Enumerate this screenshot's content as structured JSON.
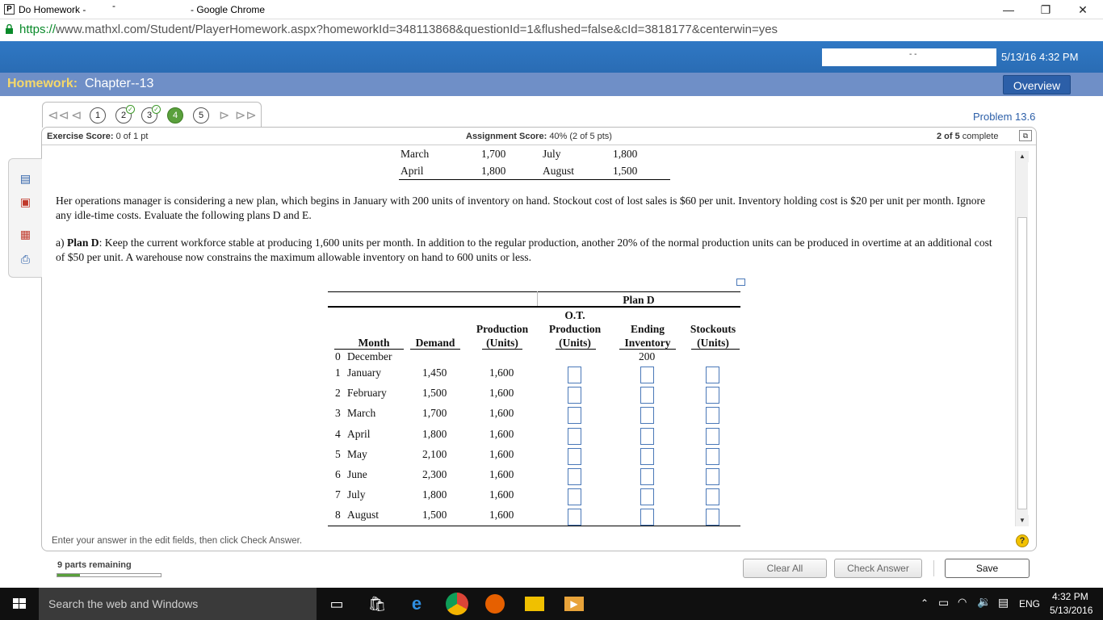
{
  "window": {
    "tab_title": "Do Homework -",
    "title_dash": "-",
    "browser": "- Google Chrome",
    "favicon": "P",
    "minimize": "—",
    "restore": "❐",
    "close": "✕"
  },
  "address": {
    "https": "https://",
    "rest": "www.mathxl.com/Student/PlayerHomework.aspx?homeworkId=348113868&questionId=1&flushed=false&cId=3818177&centerwin=yes"
  },
  "header": {
    "datetime": "5/13/16 4:32 PM",
    "redact_dash": "- -",
    "homework_label": "Homework:",
    "homework_title": "Chapter--13",
    "overview": "Overview"
  },
  "nav": {
    "questions": [
      "1",
      "2",
      "3",
      "4",
      "5"
    ],
    "problem": "Problem 13.6"
  },
  "score": {
    "exercise_label": "Exercise Score:",
    "exercise_value": "0 of 1 pt",
    "assignment_label": "Assignment Score:",
    "assignment_value": "40% (2 of 5 pts)",
    "complete_count": "2 of 5",
    "complete_label": "complete"
  },
  "top_table": {
    "rows": [
      [
        "March",
        "1,700",
        "July",
        "1,800"
      ],
      [
        "April",
        "1,800",
        "August",
        "1,500"
      ]
    ]
  },
  "problem": {
    "paragraph1": "Her operations manager is considering a new plan, which begins in January with 200 units of inventory on hand. Stockout cost of lost sales is $60 per unit. Inventory holding cost is $20 per unit per month. Ignore any idle-time costs. Evaluate the following plans D and E.",
    "part_a_prefix": "a) ",
    "part_a_bold": "Plan D",
    "part_a_text": ": Keep the current workforce stable at producing 1,600 units per month. In addition to the regular production, another 20% of the normal production units can be produced in overtime at an additional cost of $50 per unit. A warehouse now constrains the maximum allowable inventory on hand to 600 units or less."
  },
  "plan_table": {
    "plan_title": "Plan D",
    "headers": {
      "month": "Month",
      "demand": "Demand",
      "production": [
        "Production",
        "(Units)"
      ],
      "ot": [
        "O.T.",
        "Production",
        "(Units)"
      ],
      "ending": [
        "Ending",
        "Inventory"
      ],
      "stockouts": [
        "Stockouts",
        "(Units)"
      ]
    },
    "december": {
      "num": "0",
      "month": "December",
      "ending": "200"
    },
    "rows": [
      {
        "num": "1",
        "month": "January",
        "demand": "1,450",
        "production": "1,600"
      },
      {
        "num": "2",
        "month": "February",
        "demand": "1,500",
        "production": "1,600"
      },
      {
        "num": "3",
        "month": "March",
        "demand": "1,700",
        "production": "1,600"
      },
      {
        "num": "4",
        "month": "April",
        "demand": "1,800",
        "production": "1,600"
      },
      {
        "num": "5",
        "month": "May",
        "demand": "2,100",
        "production": "1,600"
      },
      {
        "num": "6",
        "month": "June",
        "demand": "2,300",
        "production": "1,600"
      },
      {
        "num": "7",
        "month": "July",
        "demand": "1,800",
        "production": "1,600"
      },
      {
        "num": "8",
        "month": "August",
        "demand": "1,500",
        "production": "1,600"
      }
    ]
  },
  "footer": {
    "hint": "Enter your answer in the edit fields, then click Check Answer.",
    "help": "?",
    "parts_remaining": "9 parts remaining",
    "progress_fraction": 0.22,
    "clear_all": "Clear All",
    "check_answer": "Check Answer",
    "save": "Save"
  },
  "taskbar": {
    "search": "Search the web and Windows",
    "lang": "ENG",
    "time": "4:32 PM",
    "date": "5/13/2016"
  }
}
